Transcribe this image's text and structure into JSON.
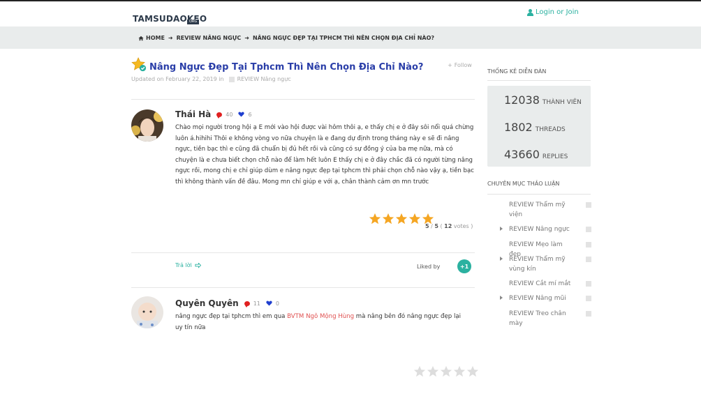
{
  "header": {
    "logo_text": "TAMSUDAOKEO",
    "logo_sub": "ORG",
    "login_label": "Login or Join"
  },
  "breadcrumb": {
    "home": "HOME",
    "level1": "REVIEW NÂNG NGỰC",
    "level2": "NÂNG NGỰC ĐẸP TẠI TPHCM THÌ NÊN CHỌN ĐỊA CHỈ NÀO?"
  },
  "thread": {
    "title": "Nâng Ngực Đẹp Tại Tphcm Thì Nên Chọn Địa Chỉ Nào?",
    "follow_label": "Follow",
    "updated_text": "Updated on February 22, 2019 in",
    "category": "REVIEW Nâng ngực"
  },
  "posts": [
    {
      "author": "Thái Hà",
      "comments": "40",
      "likes": "6",
      "text": "Chào mọi người trong hội ạ E mới vào hội được vài hôm thôi ạ, e thấy chị e ở đây sôi nổi quá chừng luôn á.hihihi Thôi e không vòng vo nữa chuyện là e đang dự định trong tháng này e sẽ đi nâng ngực, tiền bạc thì e cũng đã chuẩn bị đủ hết rồi và cũng có sự đồng ý của ba mẹ nữa, mà có chuyện là e chưa biết chọn chỗ nào để làm hết luôn E thấy chị e ở đây chắc đã có người từng nâng ngực rồi, mong chị e chỉ giúp dùm e nâng ngực đẹp tại tphcm thì phải chọn chỗ nào vậy ạ, tiền bạc thì không thành vấn đề đâu. Mong mn chỉ giúp e với ạ, chân thành cảm ơn mn trước",
      "rating_score": "5",
      "rating_max": "5",
      "rating_votes": "12",
      "rating_votes_label": "votes",
      "rating_stars": 5,
      "reply_label": "Trả lời",
      "liked_by_label": "Liked by",
      "plus_label": "+1"
    },
    {
      "author": "Quyên Quyên",
      "comments": "11",
      "likes": "0",
      "text_before": "nâng ngực đẹp tại tphcm thì em qua ",
      "text_link": "BVTM Ngô Mộng Hùng",
      "text_after": " mà nâng bên đó nâng ngực đẹp lại uy tín nữa",
      "rating_stars": 0
    }
  ],
  "sidebar": {
    "stats_heading": "THỐNG KÊ DIỄN ĐÀN",
    "stats": [
      {
        "value": "12038",
        "label": "THÀNH VIÊN"
      },
      {
        "value": "1802",
        "label": "THREADS"
      },
      {
        "value": "43660",
        "label": "REPLIES"
      }
    ],
    "categories_heading": "CHUYÊN MỤC THẢO LUẬN",
    "categories": [
      {
        "label": "REVIEW Thẩm mỹ viện",
        "has_children": false
      },
      {
        "label": "REVIEW Nâng ngực",
        "has_children": true
      },
      {
        "label": "REVIEW Mẹo làm đẹp",
        "has_children": false
      },
      {
        "label": "REVIEW Thẩm mỹ vùng kín",
        "has_children": true
      },
      {
        "label": "REVIEW Cắt mí mắt",
        "has_children": false
      },
      {
        "label": "REVIEW Nâng mũi",
        "has_children": true
      },
      {
        "label": "REVIEW Treo chân mày",
        "has_children": false
      }
    ]
  },
  "colors": {
    "accent": "#2bb1a0",
    "title": "#2a3ea8",
    "star_on": "#f5a623",
    "star_off": "#dddddd",
    "comment": "#e02020",
    "heart": "#1f3fcf"
  }
}
